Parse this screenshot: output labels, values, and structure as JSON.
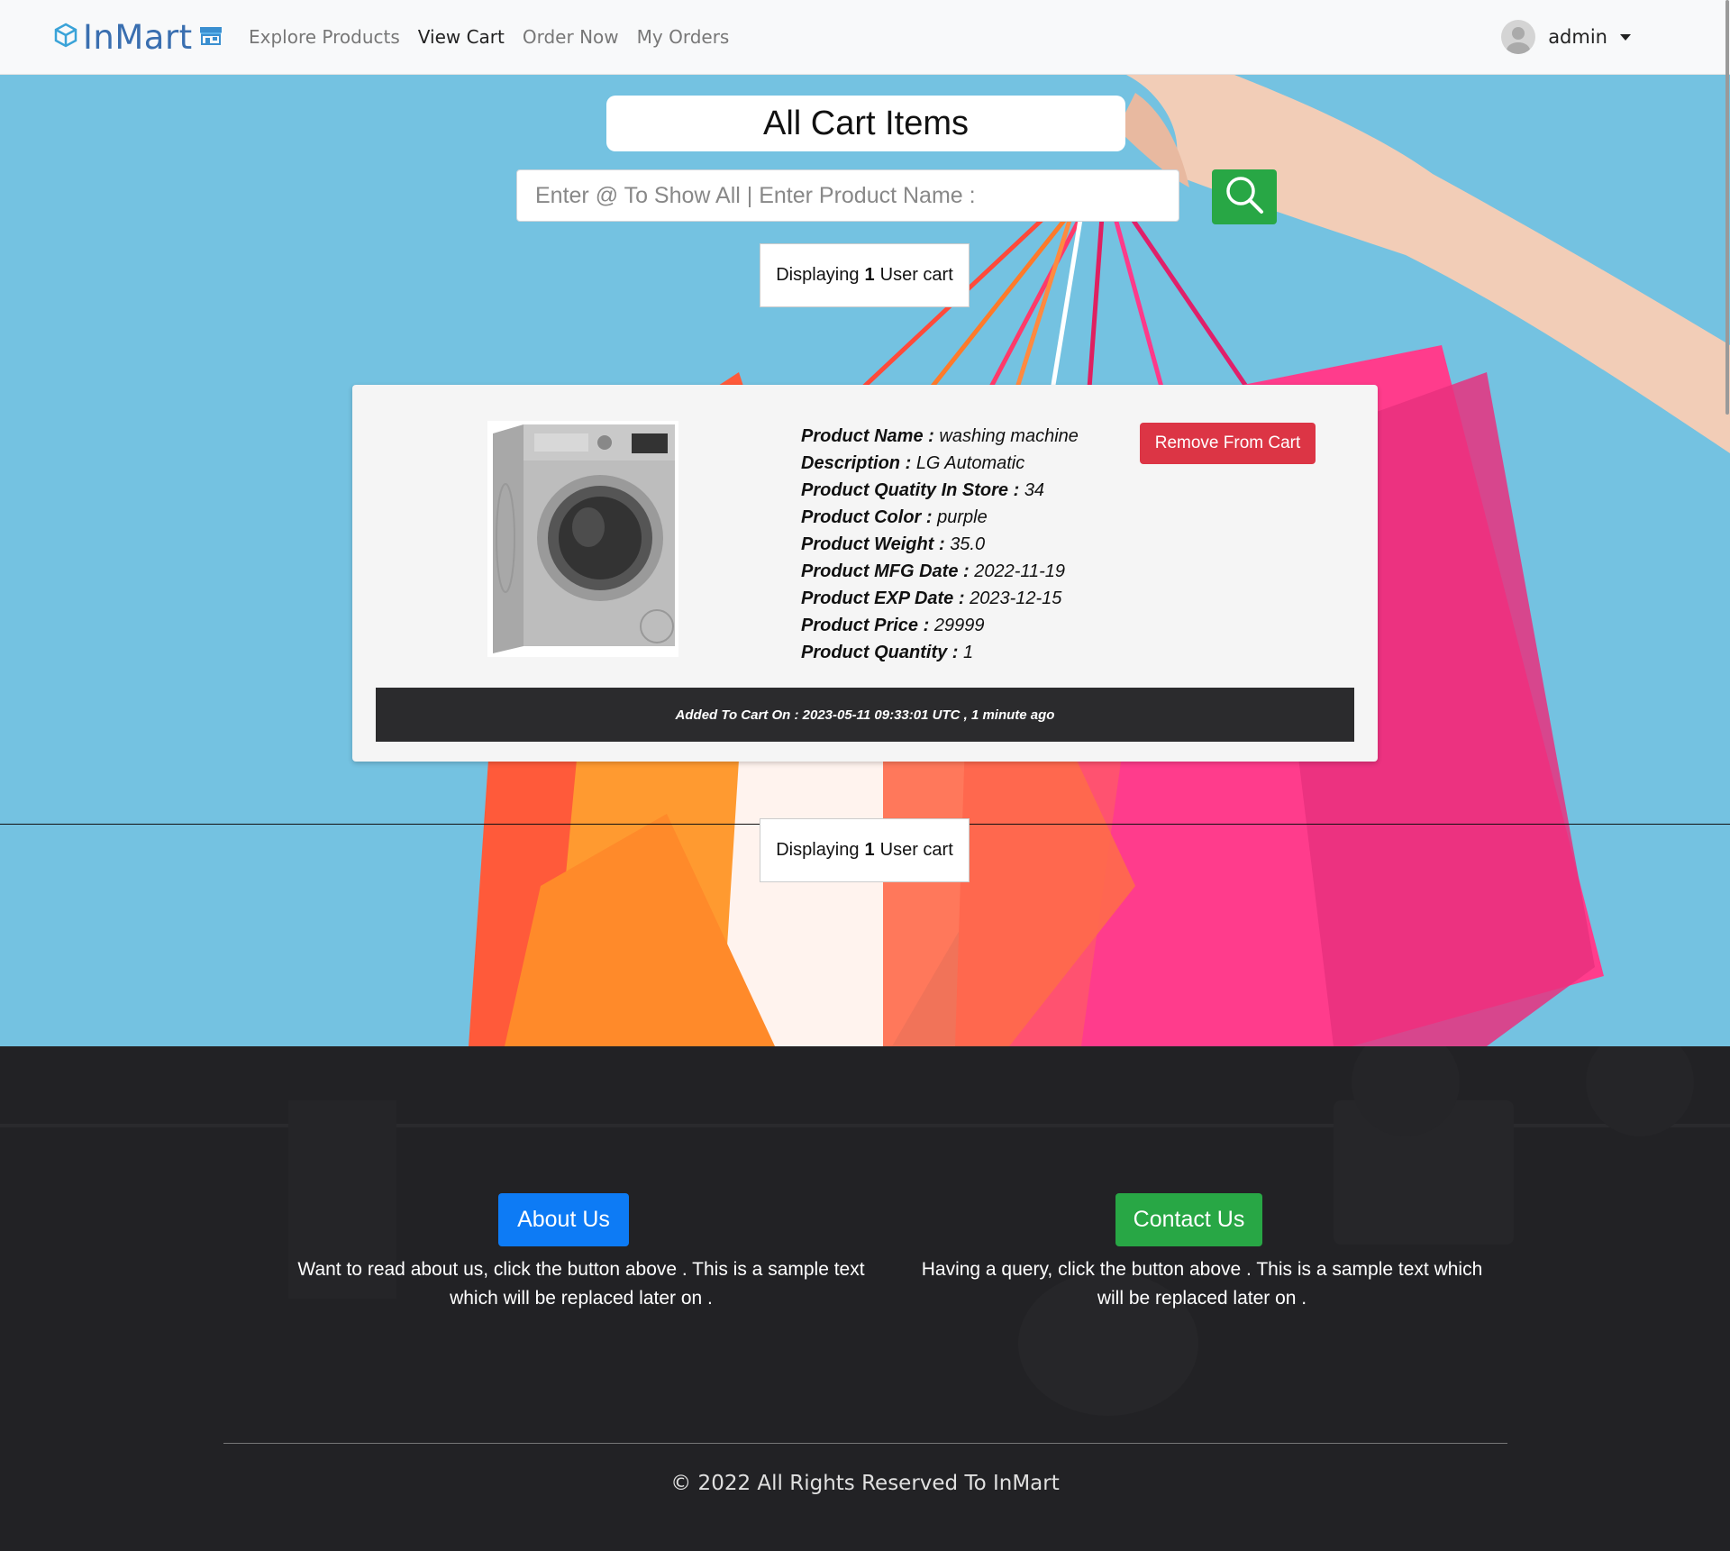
{
  "navbar": {
    "brand": "InMart",
    "links": [
      "Explore Products",
      "View Cart",
      "Order Now",
      "My Orders"
    ],
    "active_index": 1,
    "user": "admin"
  },
  "page": {
    "title": "All Cart Items",
    "search_placeholder": "Enter @ To Show All | Enter Product Name :",
    "count_prefix": "Displaying",
    "count_value": "1",
    "count_suffix": "User cart"
  },
  "cart_item": {
    "fields": [
      {
        "key": "Product Name :",
        "value": "washing machine"
      },
      {
        "key": "Description :",
        "value": "LG Automatic"
      },
      {
        "key": "Product Quatity In Store :",
        "value": "34"
      },
      {
        "key": "Product Color :",
        "value": "purple"
      },
      {
        "key": "Product Weight :",
        "value": "35.0"
      },
      {
        "key": "Product MFG Date :",
        "value": "2022-11-19"
      },
      {
        "key": "Product EXP Date :",
        "value": "2023-12-15"
      },
      {
        "key": "Product Price :",
        "value": "29999"
      },
      {
        "key": "Product Quantity :",
        "value": "1"
      }
    ],
    "remove_label": "Remove From Cart",
    "added_on": "Added To Cart On : 2023-05-11 09:33:01 UTC , 1 minute ago"
  },
  "footer": {
    "about_label": "About Us",
    "about_text": "Want to read about us, click the button above . This is a sample text which will be replaced later on .",
    "contact_label": "Contact Us",
    "contact_text": "Having a query, click the button above . This is a sample text which will be replaced later on .",
    "copyright": "© 2022 All Rights Reserved To InMart"
  },
  "colors": {
    "hero_bg": "#74c2e1",
    "danger": "#dc3545",
    "success": "#28a745",
    "primary": "#0d7bf5",
    "footer_bg": "#222225"
  },
  "icons": [
    "cube-logo-icon",
    "store-icon",
    "user-avatar-icon",
    "caret-down-icon",
    "search-icon"
  ]
}
